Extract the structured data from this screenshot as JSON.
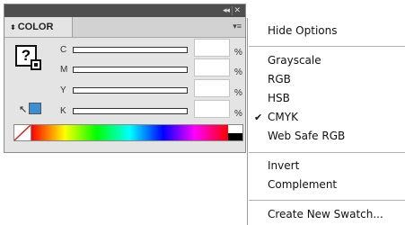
{
  "panel": {
    "title_controls": {
      "collapse": "◂◂",
      "close": "✕"
    },
    "tab_label": "COLOR",
    "tab_arrows": "⬍",
    "fill_box_glyph": "?",
    "menu_button": "▾≡",
    "sliders": [
      {
        "label": "C",
        "value": "",
        "unit": "%"
      },
      {
        "label": "M",
        "value": "",
        "unit": "%"
      },
      {
        "label": "Y",
        "value": "",
        "unit": "%"
      },
      {
        "label": "K",
        "value": "",
        "unit": "%"
      }
    ],
    "default_icon": "↖",
    "swatch_color": "#3a8fd6"
  },
  "menu": {
    "items": [
      {
        "label": "Hide Options",
        "checked": false
      },
      {
        "label": "Grayscale",
        "checked": false
      },
      {
        "label": "RGB",
        "checked": false
      },
      {
        "label": "HSB",
        "checked": false
      },
      {
        "label": "CMYK",
        "checked": true
      },
      {
        "label": "Web Safe RGB",
        "checked": false
      },
      {
        "label": "Invert",
        "checked": false
      },
      {
        "label": "Complement",
        "checked": false
      },
      {
        "label": "Create New Swatch...",
        "checked": false
      }
    ],
    "check_glyph": "✔"
  }
}
